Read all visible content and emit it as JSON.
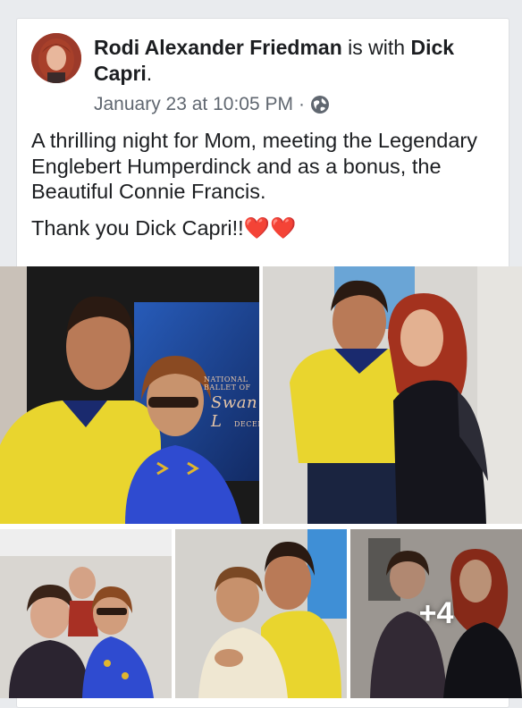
{
  "post": {
    "author": "Rodi Alexander Friedman",
    "with_text": " is with ",
    "tagged": "Dick Capri",
    "tagged_suffix": ".",
    "timestamp": "January 23 at 10:05 PM",
    "separator": "·",
    "privacy_icon": "globe-icon",
    "text_line1": "A thrilling night for Mom, meeting the Legendary Englebert Humperdinck and as a bonus, the Beautiful Connie Francis.",
    "text_line2": "Thank you Dick Capri!!",
    "hearts": "❤️❤️"
  },
  "photos": {
    "photo1_sign_text1": "NATIONAL BALLET OF",
    "photo1_sign_text2": "Swan L",
    "photo1_sign_text3": "DECEM",
    "more_count": "+4"
  },
  "colors": {
    "text_primary": "#1c1e21",
    "text_secondary": "#606770",
    "heart": "#e0245e"
  }
}
